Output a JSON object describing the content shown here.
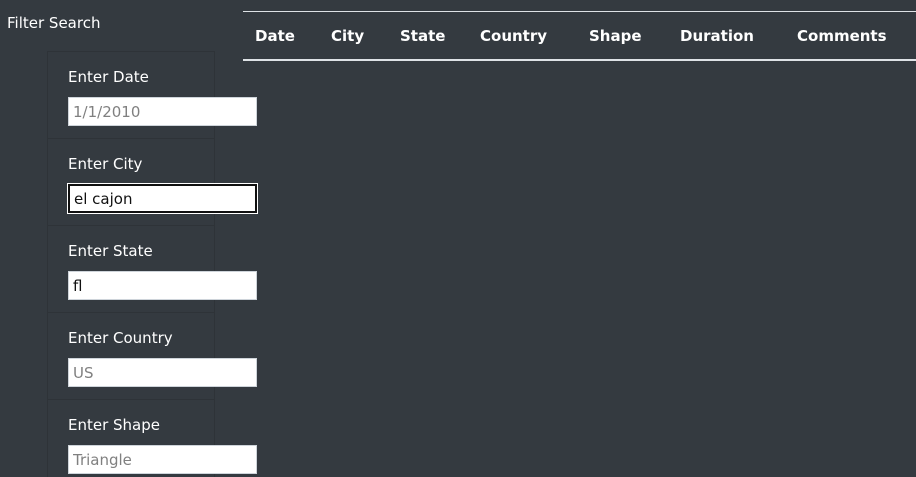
{
  "filter": {
    "title": "Filter Search",
    "fields": [
      {
        "label": "Enter Date",
        "value": "",
        "placeholder": "1/1/2010"
      },
      {
        "label": "Enter City",
        "value": "el cajon",
        "placeholder": ""
      },
      {
        "label": "Enter State",
        "value": "fl",
        "placeholder": ""
      },
      {
        "label": "Enter Country",
        "value": "",
        "placeholder": "US"
      },
      {
        "label": "Enter Shape",
        "value": "",
        "placeholder": "Triangle"
      }
    ]
  },
  "table": {
    "headers": [
      "Date",
      "City",
      "State",
      "Country",
      "Shape",
      "Duration",
      "Comments"
    ]
  }
}
